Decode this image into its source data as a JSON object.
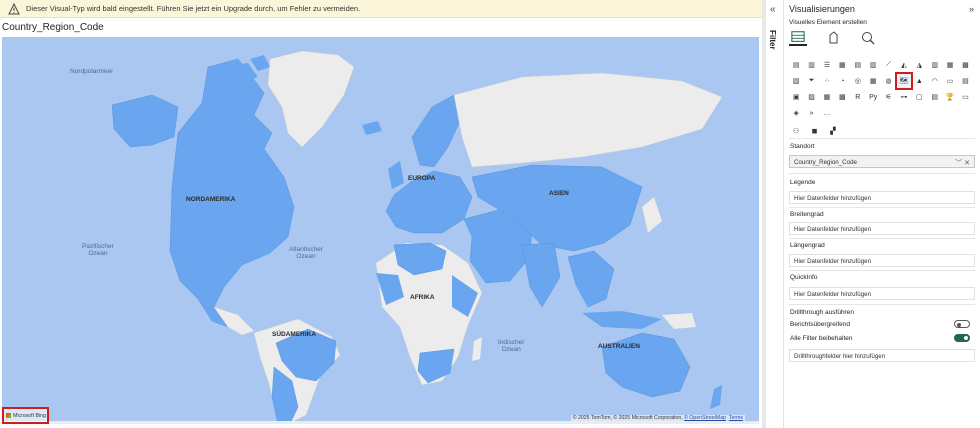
{
  "warning": {
    "text": "Dieser Visual-Typ wird bald eingestellt. Führen Sie jetzt ein Upgrade durch, um Fehler zu vermeiden.",
    "icon": "warning-triangle-icon"
  },
  "visual": {
    "title": "Country_Region_Code",
    "ocean_labels": {
      "nordpolarmeer": "Nordpolarmeer",
      "pazifischer": "Pazifischer\nOzean",
      "atlantischer": "Atlantischer\nOzean",
      "indischer": "Indischer\nOzean"
    },
    "continent_labels": {
      "nordamerika": "NORDAMERIKA",
      "europa": "EUROPA",
      "asien": "ASIEN",
      "afrika": "AFRIKA",
      "suedamerika": "SÜDAMERIKA",
      "australien": "AUSTRALIEN"
    },
    "attribution": {
      "text": "© 2025 TomTom, © 2025 Microsoft Corporation, ",
      "osm": "© OpenStreetMap",
      "terms": "Terms"
    },
    "bing_logo": "Microsoft Bing",
    "colors": {
      "ocean": "#a9c7f0",
      "highlighted_land": "#6aa5ef",
      "other_land": "#ececec"
    }
  },
  "filter_strip": {
    "label": "Filter",
    "collapse_glyph": "«"
  },
  "viz_pane": {
    "title": "Visualisierungen",
    "collapse_glyph": "»",
    "subtitle": "Visuelles Element erstellen",
    "selected_visual": "filled-map-icon",
    "fields": {
      "standort_label": "Standort",
      "standort_value": "Country_Region_Code",
      "legende_label": "Legende",
      "breitengrad_label": "Breitengrad",
      "laengengrad_label": "Längengrad",
      "quickinfo_label": "QuickInfo",
      "placeholder": "Hier Datenfelder hinzufügen"
    },
    "drillthrough": {
      "title": "Drillthrough ausführen",
      "cross_report": "Berichtsübergreifend",
      "cross_report_on": false,
      "keep_filters": "Alle Filter beibehalten",
      "keep_filters_on": true,
      "placeholder": "Drillthroughfelder hier hinzufügen"
    }
  }
}
